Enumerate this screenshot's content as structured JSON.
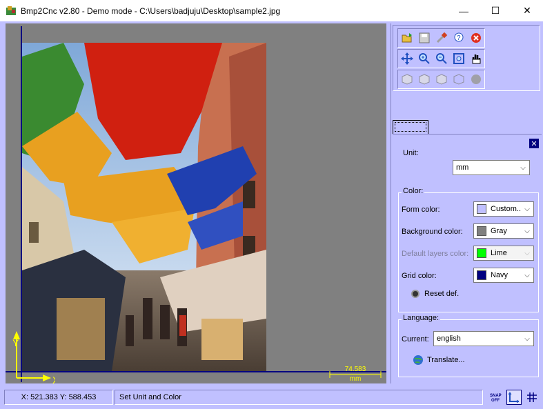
{
  "window": {
    "title": "Bmp2Cnc v2.80 - Demo mode - C:\\Users\\badjuju\\Desktop\\sample2.jpg",
    "minimize": "—",
    "maximize": "☐",
    "close": "✕"
  },
  "canvas": {
    "axis_y_label": "Y",
    "axis_x_label": "X",
    "scale_value": "74.583",
    "scale_unit": "mm"
  },
  "toolbar": {
    "row1": [
      "open-icon",
      "save-icon",
      "tools-icon",
      "help-icon",
      "close-circle-icon"
    ],
    "row2": [
      "move-icon",
      "zoom-in-icon",
      "zoom-out-icon",
      "zoom-fit-icon",
      "hand-icon"
    ],
    "row3": [
      "cube-front-icon",
      "cube-side-icon",
      "cube-top-icon",
      "cube-iso-icon",
      "sphere-icon"
    ]
  },
  "properties": {
    "unit_group": "Unit:",
    "unit_value": "mm",
    "color_group": "Color:",
    "form_color_label": "Form color:",
    "form_color_value": "Custom...",
    "background_color_label": "Background color:",
    "background_color_value": "Gray",
    "default_layers_label": "Default layers color:",
    "default_layers_value": "Lime",
    "grid_color_label": "Grid color:",
    "grid_color_value": "Navy",
    "reset_label": "Reset def.",
    "language_group": "Language:",
    "current_label": "Current:",
    "current_value": "english",
    "translate_label": "Translate..."
  },
  "colors": {
    "form_color": "#c0c0ff",
    "background_color": "#808080",
    "default_layers_color": "#00ff00",
    "grid_color": "#000080",
    "accent": "#c0c0ff"
  },
  "status": {
    "coords": "X: 521.383 Y: 588.453",
    "message": "Set Unit and Color",
    "snap_label": "SNAP OFF"
  }
}
